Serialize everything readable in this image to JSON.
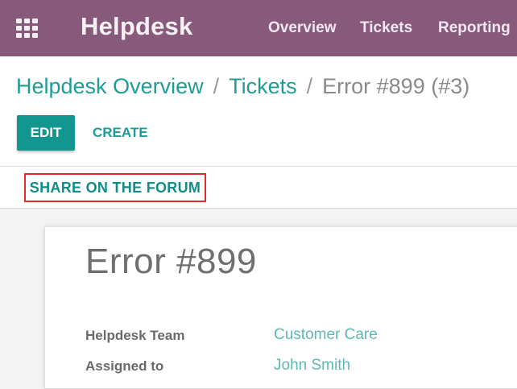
{
  "app": {
    "name": "Helpdesk",
    "menu": [
      "Overview",
      "Tickets",
      "Reporting"
    ]
  },
  "breadcrumb": {
    "items": [
      "Helpdesk Overview",
      "Tickets"
    ],
    "separator": "/",
    "current": "Error #899 (#3)"
  },
  "actions": {
    "edit_label": "EDIT",
    "create_label": "CREATE"
  },
  "statusbar": {
    "share_label": "SHARE ON THE FORUM"
  },
  "ticket": {
    "title": "Error #899",
    "fields": [
      {
        "label": "Helpdesk Team",
        "value": "Customer Care"
      },
      {
        "label": "Assigned to",
        "value": "John Smith"
      }
    ]
  },
  "colors": {
    "topbar": "#875a7b",
    "accent": "#13968f",
    "highlight_border": "#e02b2b"
  },
  "icons": {
    "apps": "apps-grid-icon"
  }
}
